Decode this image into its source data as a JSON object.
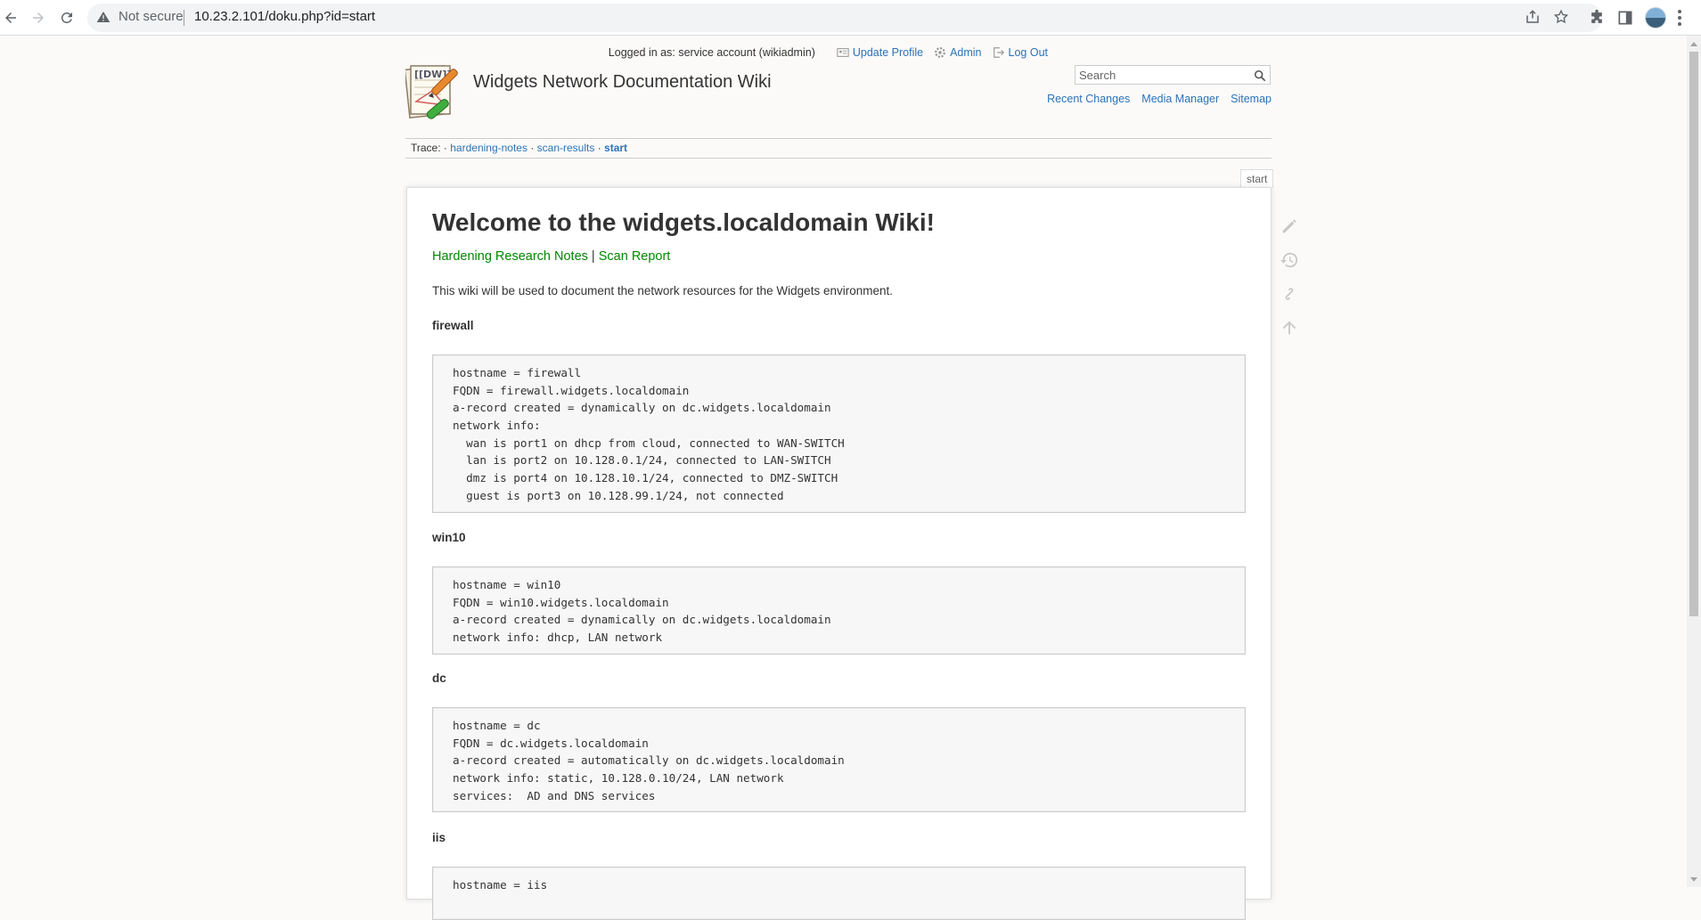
{
  "browser": {
    "security_label": "Not secure",
    "url": "10.23.2.101/doku.php?id=start"
  },
  "header": {
    "site_title": "Widgets Network Documentation Wiki",
    "logged_in": "Logged in as: service account (wikiadmin)",
    "user_links": [
      "Update Profile",
      "Admin",
      "Log Out"
    ],
    "search_placeholder": "Search",
    "site_links": [
      "Recent Changes",
      "Media Manager",
      "Sitemap"
    ]
  },
  "breadcrumb": {
    "label": "Trace:",
    "sep": "·",
    "items": [
      "hardening-notes",
      "scan-results",
      "start"
    ]
  },
  "page": {
    "id": "start",
    "title": "Welcome to the widgets.localdomain Wiki!",
    "top_links": [
      "Hardening Research Notes",
      "Scan Report"
    ],
    "top_links_sep": " | ",
    "intro": "This wiki will be used to document the network resources for the Widgets environment.",
    "sections": [
      {
        "heading": "firewall",
        "lines": [
          "hostname = firewall",
          "FQDN = firewall.widgets.localdomain",
          "a-record created = dynamically on dc.widgets.localdomain",
          "network info:",
          "  wan is port1 on dhcp from cloud, connected to WAN-SWITCH",
          "  lan is port2 on 10.128.0.1/24, connected to LAN-SWITCH",
          "  dmz is port4 on 10.128.10.1/24, connected to DMZ-SWITCH",
          "  guest is port3 on 10.128.99.1/24, not connected"
        ]
      },
      {
        "heading": "win10",
        "lines": [
          "hostname = win10",
          "FQDN = win10.widgets.localdomain",
          "a-record created = dynamically on dc.widgets.localdomain",
          "network info: dhcp, LAN network"
        ]
      },
      {
        "heading": "dc",
        "lines": [
          "hostname = dc",
          "FQDN = dc.widgets.localdomain",
          "a-record created = automatically on dc.widgets.localdomain",
          "network info: static, 10.128.0.10/24, LAN network",
          "services:  AD and DNS services"
        ]
      },
      {
        "heading": "iis",
        "lines": [
          "hostname = iis"
        ]
      }
    ]
  },
  "colors": {
    "link": "#2b73b7",
    "internal_link": "#008800",
    "text": "#333333",
    "page_bg": "#fbfaf9"
  }
}
